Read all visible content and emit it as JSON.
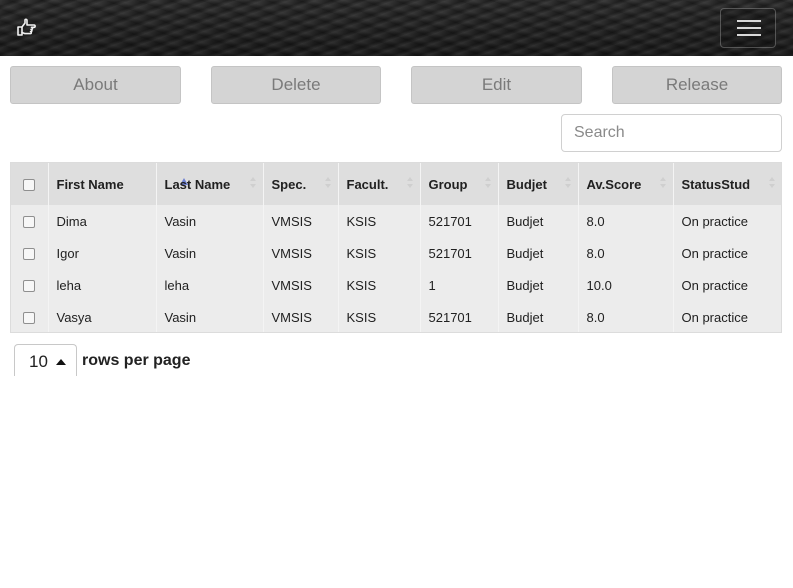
{
  "header": {
    "brand_icon": "hand-pointing-right-icon",
    "menu_icon": "hamburger-menu-icon"
  },
  "toolbar": {
    "about_label": "About",
    "delete_label": "Delete",
    "edit_label": "Edit",
    "release_label": "Release"
  },
  "search": {
    "placeholder": "Search",
    "value": ""
  },
  "table": {
    "sorted_column": "First Name",
    "sort_direction": "ascending",
    "sort_color": "#6c7fd1",
    "columns": [
      "First Name",
      "Last Name",
      "Spec.",
      "Facult.",
      "Group",
      "Budjet",
      "Av.Score",
      "StatusStud"
    ],
    "rows": [
      [
        "Dima",
        "Vasin",
        "VMSIS",
        "KSIS",
        "521701",
        "Budjet",
        "8.0",
        "On practice"
      ],
      [
        "Igor",
        "Vasin",
        "VMSIS",
        "KSIS",
        "521701",
        "Budjet",
        "8.0",
        "On practice"
      ],
      [
        "leha",
        "leha",
        "VMSIS",
        "KSIS",
        "1",
        "Budjet",
        "10.0",
        "On practice"
      ],
      [
        "Vasya",
        "Vasin",
        "VMSIS",
        "KSIS",
        "521701",
        "Budjet",
        "8.0",
        "On practice"
      ]
    ]
  },
  "pagination": {
    "rows_per_page": "10",
    "label": "rows per page"
  }
}
